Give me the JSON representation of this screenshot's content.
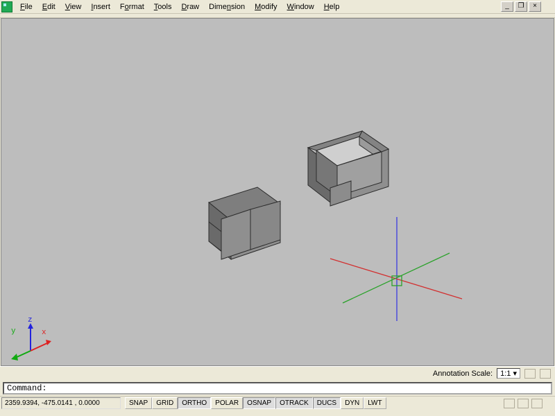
{
  "menu": {
    "items": [
      "File",
      "Edit",
      "View",
      "Insert",
      "Format",
      "Tools",
      "Draw",
      "Dimension",
      "Modify",
      "Window",
      "Help"
    ]
  },
  "window_controls": {
    "minimize": "_",
    "restore": "❐",
    "close": "×"
  },
  "annotation": {
    "label": "Annotation Scale:",
    "value": "1:1",
    "dropdown_glyph": "▾"
  },
  "command": {
    "prompt": "Command:"
  },
  "status": {
    "coords": "2359.9394, -475.0141 , 0.0000",
    "toggles": [
      "SNAP",
      "GRID",
      "ORTHO",
      "POLAR",
      "OSNAP",
      "OTRACK",
      "DUCS",
      "DYN",
      "LWT"
    ],
    "pressed": [
      false,
      false,
      true,
      false,
      true,
      true,
      true,
      false,
      false
    ]
  },
  "ucs": {
    "x": "x",
    "y": "y",
    "z": "z"
  }
}
